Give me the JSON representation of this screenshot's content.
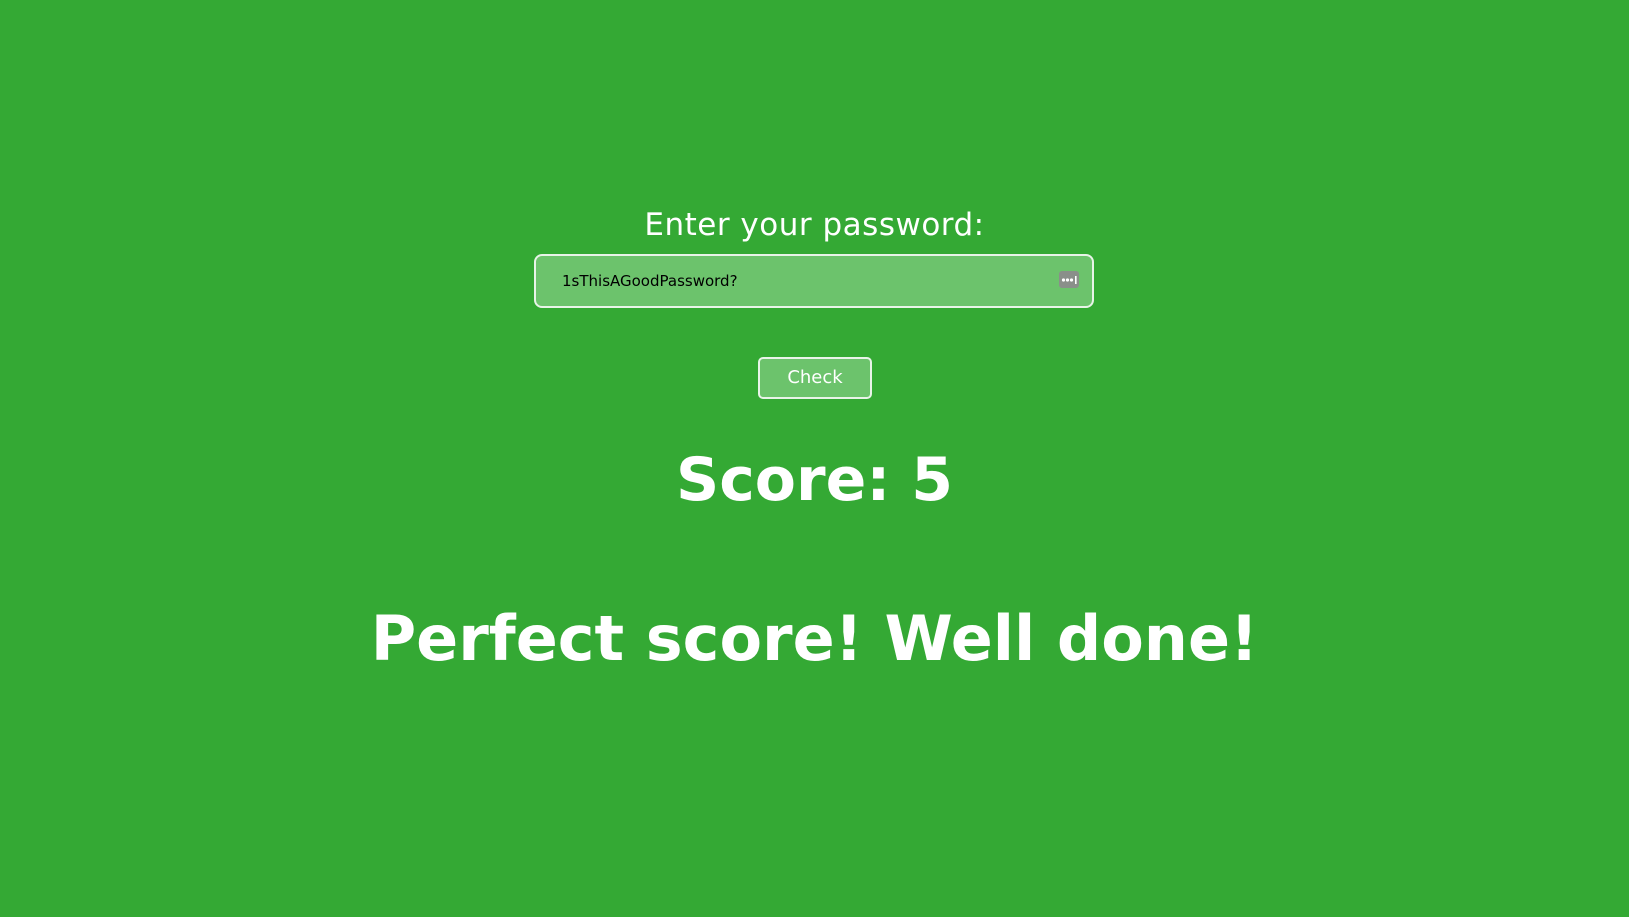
{
  "colors": {
    "background": "#34a934",
    "field_background": "#6cc36c",
    "border": "#e8f4e8",
    "text": "#ffffff"
  },
  "form": {
    "prompt_label": "Enter your password:",
    "password_value": "1sThisAGoodPassword?",
    "reveal_icon": "password-manager-icon",
    "check_label": "Check"
  },
  "result": {
    "score_text": "Score: 5",
    "message": "Perfect score! Well done!"
  }
}
